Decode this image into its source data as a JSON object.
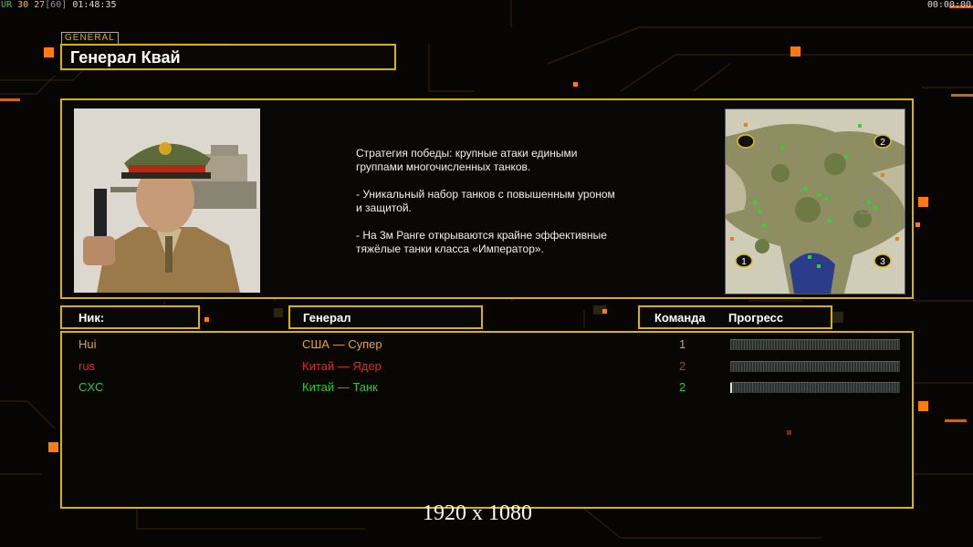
{
  "hud": {
    "ur_label": "UR",
    "fps": "30",
    "fps2": "27",
    "fps_target": "[60]",
    "time_left": "01:48:35",
    "time_right": "00:00:00"
  },
  "header": {
    "tag": "GENERAL",
    "title": "Генерал Квай"
  },
  "info": {
    "strategy_text": "Стратегия победы: крупные атаки едиными\n группами многочисленных танков.\n\n- Уникальный набор танков с повышенным уроном\n и защитой.\n\n- На 3м Ранге открываются крайне эффективные\n тяжёлые танки класса «Император».",
    "minimap_labels": [
      "2",
      "1",
      "3"
    ]
  },
  "columns": {
    "nick": "Ник:",
    "general": "Генерал",
    "team": "Команда",
    "progress": "Прогресс"
  },
  "players": [
    {
      "nick": "Hui",
      "general": "США — Супер",
      "team": "1",
      "color": "#e8a33a",
      "progress": 0
    },
    {
      "nick": "rus",
      "general": "Китай — Ядер",
      "team": "2",
      "color": "#e8261e",
      "progress": 0
    },
    {
      "nick": "CXC",
      "general": "Китай — Танк",
      "team": "2",
      "color": "#32c832",
      "progress": 0.01
    }
  ],
  "footer": {
    "resolution": "1920 x 1080"
  },
  "colors": {
    "accent": "#d8b400",
    "hud_orange": "#ff8c1a"
  }
}
